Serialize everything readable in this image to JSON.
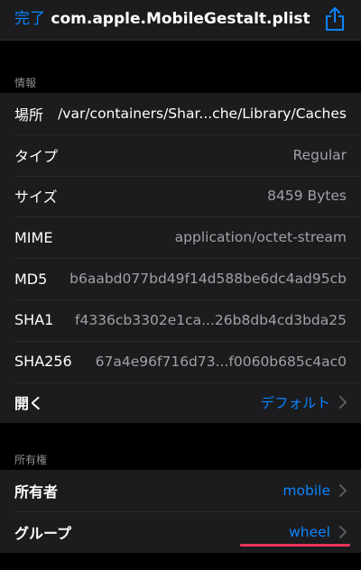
{
  "nav": {
    "done_label": "完了",
    "title": "com.apple.MobileGestalt.plist",
    "share_icon": "share-icon"
  },
  "info": {
    "header": "情報",
    "rows": [
      {
        "label": "場所",
        "value": "/var/containers/Shar...che/Library/Caches"
      },
      {
        "label": "タイプ",
        "value": "Regular"
      },
      {
        "label": "サイズ",
        "value": "8459 Bytes"
      },
      {
        "label": "MIME",
        "value": "application/octet-stream"
      },
      {
        "label": "MD5",
        "value": "b6aabd077bd49f14d588be6dc4ad95cb"
      },
      {
        "label": "SHA1",
        "value": "f4336cb3302e1ca...26b8db4cd3bda25"
      },
      {
        "label": "SHA256",
        "value": "67a4e96f716d73...f0060b685c4ac0"
      },
      {
        "label": "開く",
        "value": "デフォルト"
      }
    ]
  },
  "ownership": {
    "header": "所有権",
    "rows": [
      {
        "label": "所有者",
        "value": "mobile"
      },
      {
        "label": "グループ",
        "value": "wheel"
      }
    ]
  },
  "colors": {
    "accent": "#0a84ff",
    "highlight_underline": "#e8345a"
  }
}
